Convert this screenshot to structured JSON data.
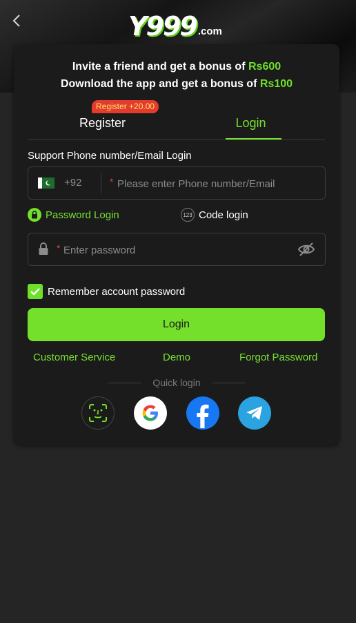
{
  "header": {
    "logo_text": "Y999",
    "logo_suffix": ".com"
  },
  "promo": {
    "line1_prefix": "Invite a friend and get a bonus of ",
    "line1_amount": "Rs600",
    "line2_prefix": "Download the app and get a bonus of ",
    "line2_amount": "Rs100"
  },
  "tabs": {
    "register": "Register",
    "login": "Login",
    "register_badge": "Register +20.00",
    "active": "login"
  },
  "form": {
    "support_label": "Support Phone number/Email Login",
    "country_code": "+92",
    "phone_placeholder": "Please enter Phone number/Email",
    "mode_password": "Password Login",
    "mode_code": "Code login",
    "password_placeholder": "Enter password",
    "remember_label": "Remember account password",
    "remember_checked": true,
    "login_button": "Login"
  },
  "links": {
    "customer_service": "Customer Service",
    "demo": "Demo",
    "forgot_password": "Forgot Password"
  },
  "quick_login": {
    "label": "Quick login",
    "providers": [
      "face-id-icon",
      "google-icon",
      "facebook-icon",
      "telegram-icon"
    ]
  },
  "colors": {
    "accent": "#74e02b",
    "background": "#252525",
    "card": "#1b1b1b",
    "badge": "#e33b2e",
    "required": "#e0443a"
  }
}
